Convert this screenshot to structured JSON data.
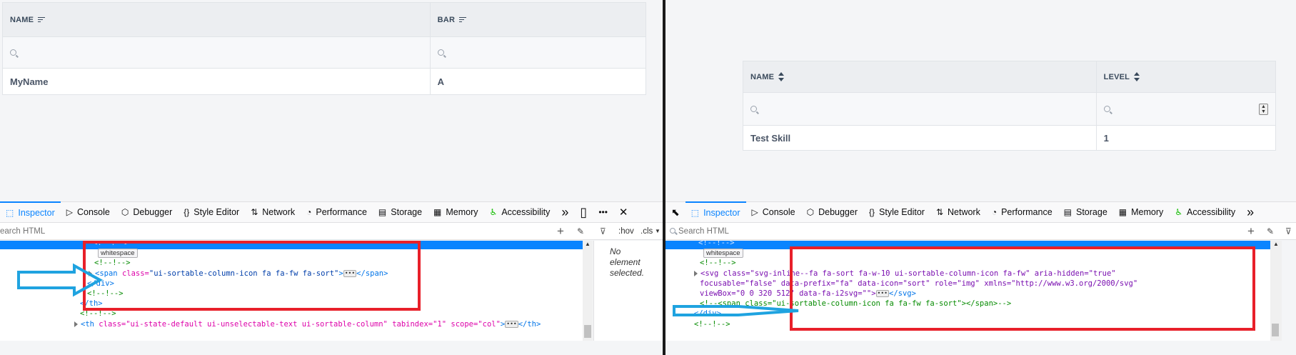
{
  "left_table": {
    "columns": [
      {
        "label": "NAME"
      },
      {
        "label": "BAR"
      }
    ],
    "rows": [
      [
        "MyName",
        "A"
      ]
    ]
  },
  "right_table": {
    "columns": [
      {
        "label": "NAME"
      },
      {
        "label": "LEVEL"
      }
    ],
    "rows": [
      [
        "Test Skill",
        "1"
      ]
    ]
  },
  "devtools_tabs": [
    {
      "label": "Inspector",
      "icon": "inspector-icon"
    },
    {
      "label": "Console",
      "icon": "console-icon"
    },
    {
      "label": "Debugger",
      "icon": "debugger-icon"
    },
    {
      "label": "Style Editor",
      "icon": "braces-icon"
    },
    {
      "label": "Network",
      "icon": "network-arrows-icon"
    },
    {
      "label": "Performance",
      "icon": "gauge-icon"
    },
    {
      "label": "Storage",
      "icon": "storage-icon"
    },
    {
      "label": "Memory",
      "icon": "chip-icon"
    },
    {
      "label": "Accessibility",
      "icon": "accessibility-icon"
    }
  ],
  "left_search": {
    "placeholder": "earch HTML",
    "hov": ":hov",
    "cls": ".cls"
  },
  "right_search": {
    "placeholder": "Search HTML"
  },
  "no_element": "No element selected.",
  "left_markup": [
    {
      "indent": 130,
      "type": "comment",
      "text": "<!--!-->"
    },
    {
      "indent": 137,
      "type": "whitespace",
      "text": "whitespace"
    },
    {
      "indent": 132,
      "type": "comment",
      "text": "<!--!-->"
    },
    {
      "indent": 124,
      "type": "span",
      "tag_open": "<span ",
      "attr": "class=",
      "val": "\"ui-sortable-column-icon fa fa-fw fa-sort\"",
      "close": "></span>"
    },
    {
      "indent": 122,
      "type": "tag",
      "text": "</div>"
    },
    {
      "indent": 122,
      "type": "comment",
      "text": "<!--!-->"
    },
    {
      "indent": 112,
      "type": "tag",
      "text": "</th>"
    },
    {
      "indent": 112,
      "type": "comment",
      "text": "<!--!-->"
    },
    {
      "indent": 104,
      "type": "th",
      "tag_open": "<th ",
      "attrs": "class=\"ui-state-default ui-unselectable-text ui-sortable-column\" tabindex=\"1\" scope=\"col\"",
      "close": "</th>"
    }
  ],
  "right_markup": [
    {
      "indent": 978,
      "type": "comment",
      "text": "<!--!-->"
    },
    {
      "indent": 985,
      "type": "whitespace",
      "text": "whitespace"
    },
    {
      "indent": 980,
      "type": "comment",
      "text": "<!--!-->"
    },
    {
      "indent": 972,
      "type": "svg1",
      "text": "<svg class=\"svg-inline--fa fa-sort fa-w-10 ui-sortable-column-icon fa-fw\" aria-hidden=\"true\""
    },
    {
      "indent": 980,
      "type": "svg2",
      "text": "focusable=\"false\" data-prefix=\"fa\" data-icon=\"sort\" role=\"img\" xmlns=\"http://www.w3.org/2000/svg\""
    },
    {
      "indent": 980,
      "type": "svg3",
      "text": "viewBox=\"0 0 320 512\" data-fa-i2svg=\"\">"
    },
    {
      "indent": 980,
      "type": "comment",
      "text": "<!--<span class=\"ui-sortable-column-icon fa fa-fw fa-sort\"></span>-->"
    },
    {
      "indent": 972,
      "type": "tag",
      "text": "</div>"
    },
    {
      "indent": 972,
      "type": "comment",
      "text": "<!--!-->"
    }
  ]
}
